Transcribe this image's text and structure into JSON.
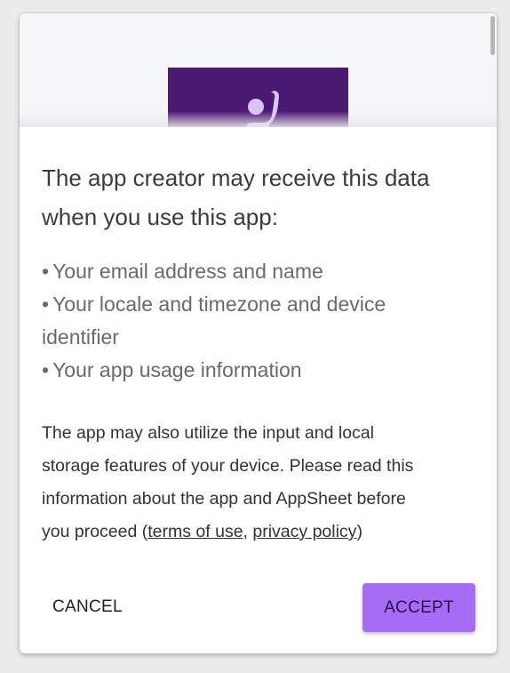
{
  "dialog": {
    "heading_line1": "The app creator may receive this data",
    "heading_line2": "when you use this app:",
    "data_items": [
      "Your email address and name",
      "Your locale and timezone and device",
      "identifier",
      "Your app usage information"
    ],
    "bullet": "•",
    "notice": {
      "line1": "The app may also utilize the input and local",
      "line2": "storage features of your device. Please read this",
      "line3": "information about the app and AppSheet before",
      "line4_prefix": "you proceed (",
      "terms_link": "terms of use",
      "separator": ", ",
      "privacy_link": "privacy policy",
      "line4_suffix": ")"
    },
    "cancel_label": "CANCEL",
    "accept_label": "ACCEPT"
  },
  "colors": {
    "banner": "#4a1a73",
    "banner_icon": "#d9c4f5",
    "accent_button": "#a66cf5"
  },
  "icons": {
    "banner_icon": "person-waving-icon"
  }
}
